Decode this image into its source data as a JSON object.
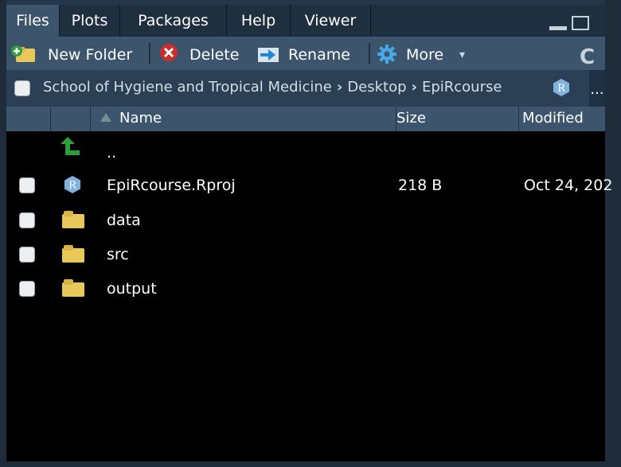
{
  "tabs": [
    {
      "label": "Files"
    },
    {
      "label": "Plots"
    },
    {
      "label": "Packages"
    },
    {
      "label": "Help"
    },
    {
      "label": "Viewer"
    }
  ],
  "toolbar": {
    "new_folder_label": "New Folder",
    "delete_label": "Delete",
    "rename_label": "Rename",
    "more_label": "More",
    "more_caret": "▾",
    "refresh_glyph": "C"
  },
  "breadcrumb": {
    "path_root": "School of Hygiene and Tropical Medicine",
    "path_mid": "Desktop",
    "path_end": "EpiRcourse",
    "separator": "›",
    "overflow": "..."
  },
  "header": {
    "name": "Name",
    "size": "Size",
    "modified": "Modified"
  },
  "rows": [
    {
      "name": "..",
      "size": "",
      "modified": "",
      "icon": "up-arrow-icon"
    },
    {
      "name": "EpiRcourse.Rproj",
      "size": "218 B",
      "modified": "Oct 24, 202",
      "icon": "r-project-icon"
    },
    {
      "name": "data",
      "size": "",
      "modified": "",
      "icon": "folder-icon"
    },
    {
      "name": "src",
      "size": "",
      "modified": "",
      "icon": "folder-icon"
    },
    {
      "name": "output",
      "size": "",
      "modified": "",
      "icon": "folder-icon"
    }
  ],
  "colors": {
    "accent": "#3c556c",
    "folder": "#e9c85a",
    "up_arrow": "#2e9e3c",
    "delete_red": "#c9302c",
    "gear_blue": "#4aa7e8"
  }
}
